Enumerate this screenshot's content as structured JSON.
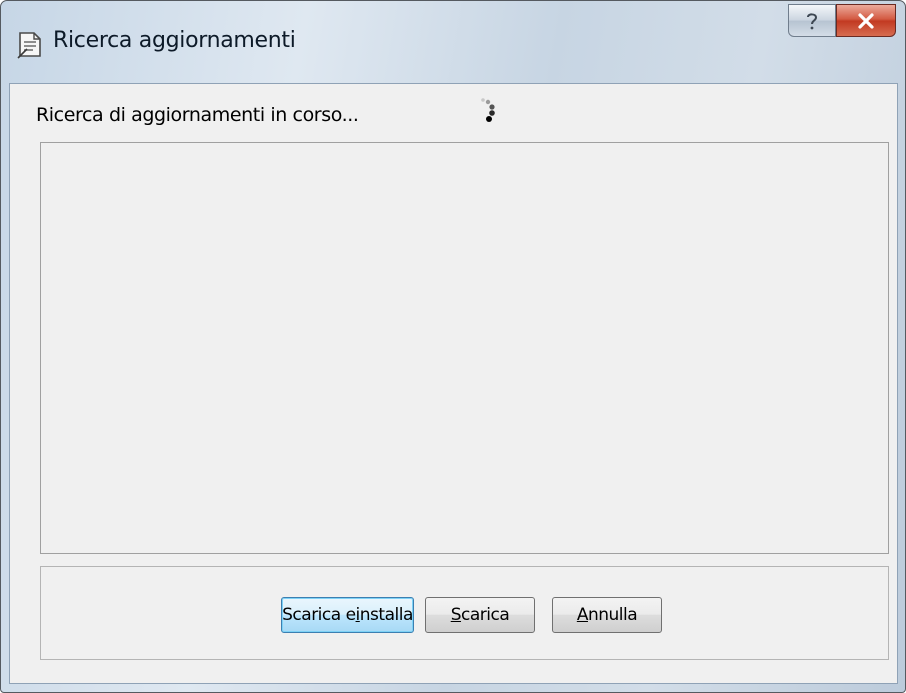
{
  "window": {
    "title": "Ricerca aggiornamenti",
    "icon": "update-document-icon",
    "help_glyph": "?",
    "close_glyph": "X"
  },
  "status": {
    "text": "Ricerca di aggiornamenti in corso...",
    "spinner_icon": "busy-spinner-icon"
  },
  "buttons": {
    "install": {
      "pre": "Scarica e ",
      "mnemonic": "i",
      "post": "nstalla"
    },
    "download": {
      "pre": "",
      "mnemonic": "S",
      "post": "carica"
    },
    "cancel": {
      "pre": "",
      "mnemonic": "A",
      "post": "nnulla"
    }
  },
  "colors": {
    "close_button": "#c23a22",
    "default_button_border": "#3c7fb1",
    "client_background": "#f0f0f0"
  }
}
